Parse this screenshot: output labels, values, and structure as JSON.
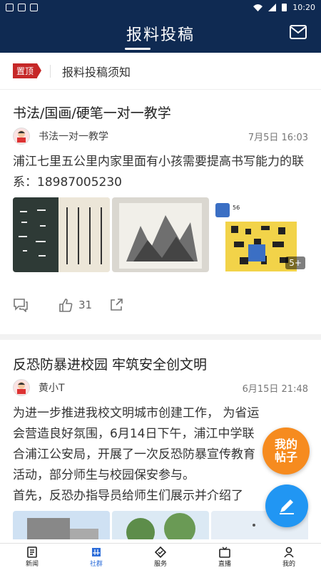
{
  "status_bar": {
    "time": "10:20"
  },
  "header": {
    "title": "报料投稿",
    "mail_icon": "mail-icon"
  },
  "pinned": {
    "badge": "置顶",
    "text": "报料投稿须知"
  },
  "posts": [
    {
      "title": "书法/国画/硬笔一对一教学",
      "author": "书法一对一教学",
      "time": "7月5日 16:03",
      "body": "浦江七里五公里内家里面有小孩需要提高书写能力的联系：18987005230",
      "more_images": "5+",
      "qr_label": "56",
      "likes": "31"
    },
    {
      "title": "反恐防暴进校园 牢筑安全创文明",
      "author": "黄小T",
      "time": "6月15日 21:48",
      "body_lines": [
        "为进一步推进我校文明城市创建工作， 为省运",
        "会营造良好氛围，6月14日下午，浦江中学联",
        "合浦江公安局，开展了一次反恐防暴宣传教育",
        "活动，部分师生与校园保安参与。",
        "首先，反恐办指导员给师生们展示并介绍了"
      ]
    }
  ],
  "fab": {
    "my_posts": "我的帖子"
  },
  "nav": [
    {
      "label": "新闻",
      "icon": "news-icon"
    },
    {
      "label": "社群",
      "icon": "community-icon"
    },
    {
      "label": "服务",
      "icon": "service-icon"
    },
    {
      "label": "直播",
      "icon": "live-icon"
    },
    {
      "label": "我的",
      "icon": "profile-icon"
    }
  ],
  "colors": {
    "header": "#0f2a52",
    "accent": "#2b6cd9",
    "fab_orange": "#f68b1f",
    "fab_blue": "#2196f3",
    "pin": "#c62828"
  }
}
